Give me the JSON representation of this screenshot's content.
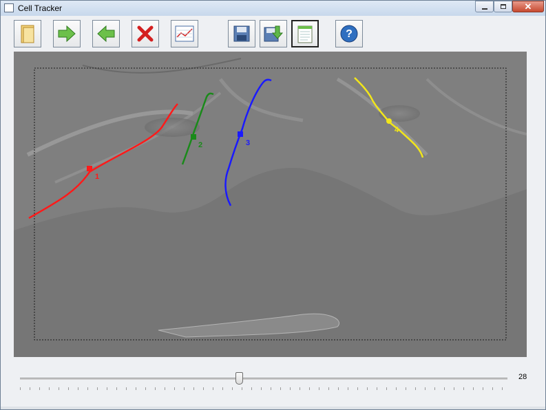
{
  "window": {
    "title": "Cell Tracker",
    "controls": {
      "minimize": "minimize",
      "maximize": "maximize",
      "close": "✕"
    }
  },
  "toolbar": {
    "buttons": [
      {
        "name": "open-folder-button",
        "icon": "folder-icon"
      },
      {
        "name": "next-button",
        "icon": "arrow-right-icon"
      },
      {
        "name": "previous-button",
        "icon": "arrow-left-icon"
      },
      {
        "name": "delete-button",
        "icon": "red-x-icon"
      },
      {
        "name": "chart-button",
        "icon": "chart-icon"
      },
      {
        "name": "save-button",
        "icon": "disk-icon"
      },
      {
        "name": "export-button",
        "icon": "disk-download-icon"
      },
      {
        "name": "notes-button",
        "icon": "notepad-icon",
        "pressed": true
      },
      {
        "name": "help-button",
        "icon": "help-icon"
      }
    ]
  },
  "tracks": [
    {
      "id": "1",
      "color": "#ff1a1a"
    },
    {
      "id": "2",
      "color": "#1a8a1a"
    },
    {
      "id": "3",
      "color": "#1a1aff"
    },
    {
      "id": "4",
      "color": "#f2e61a"
    }
  ],
  "slider": {
    "value": "28"
  }
}
